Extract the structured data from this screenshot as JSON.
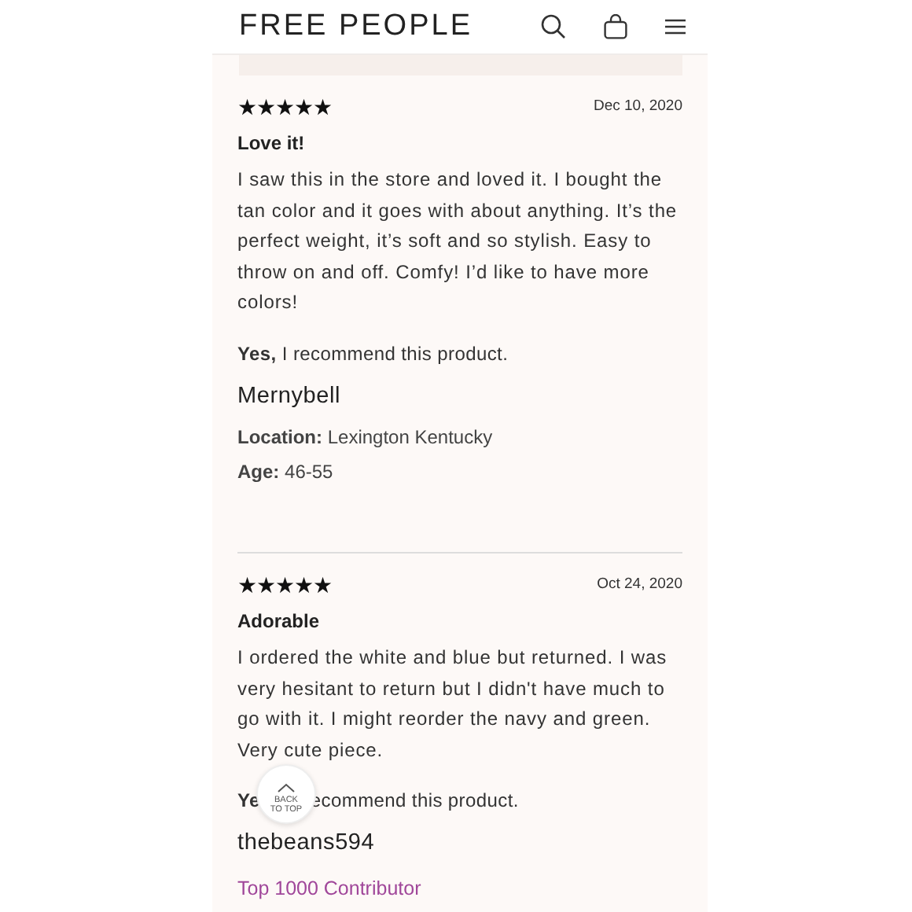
{
  "header": {
    "logo": "FREE PEOPLE"
  },
  "reviews": [
    {
      "stars": 5,
      "date": "Dec 10, 2020",
      "title": "Love it!",
      "body": "I saw this in the store and loved it. I bought the tan color and it goes with about anything. It’s the perfect weight, it’s soft and so stylish. Easy to throw on and off. Comfy! I’d like to have more colors!",
      "recommend": {
        "lead": "Yes,",
        "text": "I recommend this product.",
        "covered": false
      },
      "author": "Mernybell",
      "details": [
        {
          "label": "Location:",
          "value": "Lexington Kentucky"
        },
        {
          "label": "Age:",
          "value": "46-55"
        }
      ]
    },
    {
      "stars": 5,
      "date": "Oct 24, 2020",
      "title": "Adorable",
      "body": "I ordered the white and blue but returned. I was very hesitant to return but I didn't have much to go with it. I might reorder the navy and green. Very cute piece.",
      "recommend": {
        "lead": "Ye",
        "text": "ecommend this product.",
        "covered": true
      },
      "author": "thebeans594",
      "badge": "Top 1000 Contributor"
    }
  ],
  "back_to_top": {
    "lines": [
      "BACK",
      "TO TOP"
    ]
  }
}
